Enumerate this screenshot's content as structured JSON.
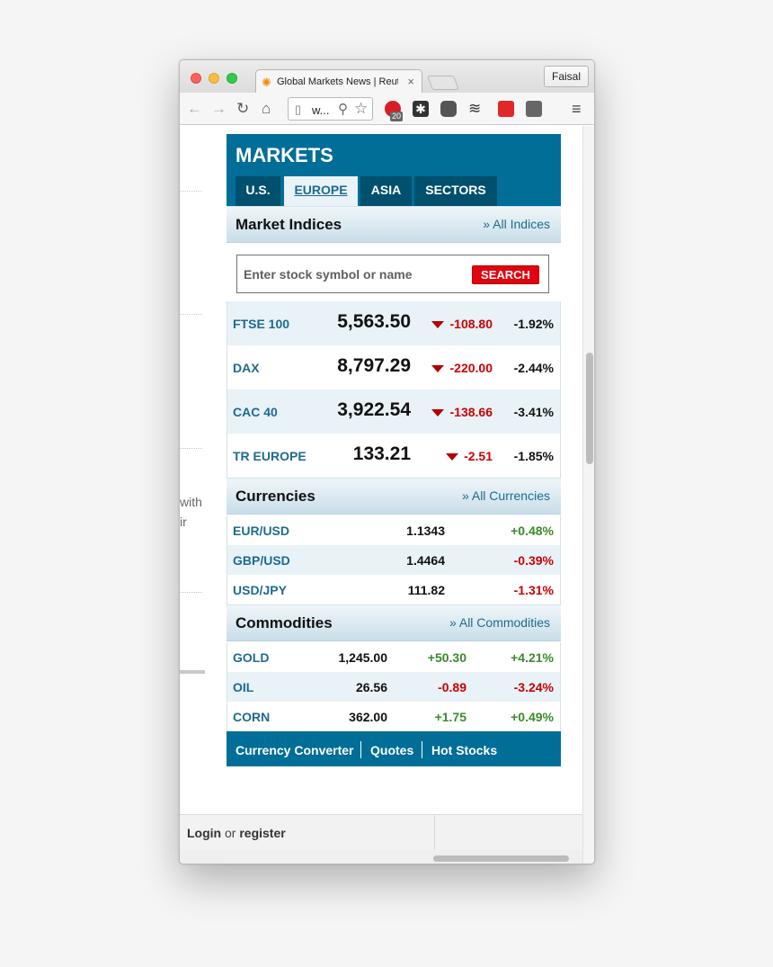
{
  "browser": {
    "tab_title": "Global Markets News | Reuters",
    "profile_name": "Faisal",
    "url_display": "w...",
    "extension_badge": "20"
  },
  "page_left": {
    "fragments": [
      "with",
      "ir"
    ]
  },
  "markets": {
    "title": "MARKETS",
    "tabs": [
      {
        "label": "U.S.",
        "active": false
      },
      {
        "label": "EUROPE",
        "active": true
      },
      {
        "label": "ASIA",
        "active": false
      },
      {
        "label": "SECTORS",
        "active": false
      }
    ],
    "indices_section": {
      "title": "Market Indices",
      "link": "» All Indices"
    },
    "search": {
      "placeholder": "Enter stock symbol or name",
      "button": "SEARCH"
    },
    "indices": [
      {
        "name": "FTSE 100",
        "price": "5,563.50",
        "change": "-108.80",
        "pct": "-1.92%",
        "direction": "down"
      },
      {
        "name": "DAX",
        "price": "8,797.29",
        "change": "-220.00",
        "pct": "-2.44%",
        "direction": "down"
      },
      {
        "name": "CAC 40",
        "price": "3,922.54",
        "change": "-138.66",
        "pct": "-3.41%",
        "direction": "down"
      },
      {
        "name": "TR EUROPE",
        "price": "133.21",
        "change": "-2.51",
        "pct": "-1.85%",
        "direction": "down"
      }
    ],
    "currencies_section": {
      "title": "Currencies",
      "link": "» All Currencies"
    },
    "currencies": [
      {
        "pair": "EUR/USD",
        "value": "1.1343",
        "pct": "+0.48%",
        "direction": "up"
      },
      {
        "pair": "GBP/USD",
        "value": "1.4464",
        "pct": "-0.39%",
        "direction": "down"
      },
      {
        "pair": "USD/JPY",
        "value": "111.82",
        "pct": "-1.31%",
        "direction": "down"
      }
    ],
    "commodities_section": {
      "title": "Commodities",
      "link": "» All Commodities"
    },
    "commodities": [
      {
        "name": "GOLD",
        "value": "1,245.00",
        "change": "+50.30",
        "pct": "+4.21%",
        "direction": "up"
      },
      {
        "name": "OIL",
        "value": "26.56",
        "change": "-0.89",
        "pct": "-3.24%",
        "direction": "down"
      },
      {
        "name": "CORN",
        "value": "362.00",
        "change": "+1.75",
        "pct": "+0.49%",
        "direction": "up"
      }
    ],
    "footer_links": [
      "Currency Converter",
      "Quotes",
      "Hot Stocks"
    ]
  },
  "login": {
    "login_label": "Login",
    "or_label": "or",
    "register_label": "register"
  },
  "colors": {
    "brand_blue": "#006e96",
    "tab_dark": "#00506e",
    "search_red": "#e0040f",
    "positive": "#3a8a2c",
    "negative": "#cc0000"
  }
}
